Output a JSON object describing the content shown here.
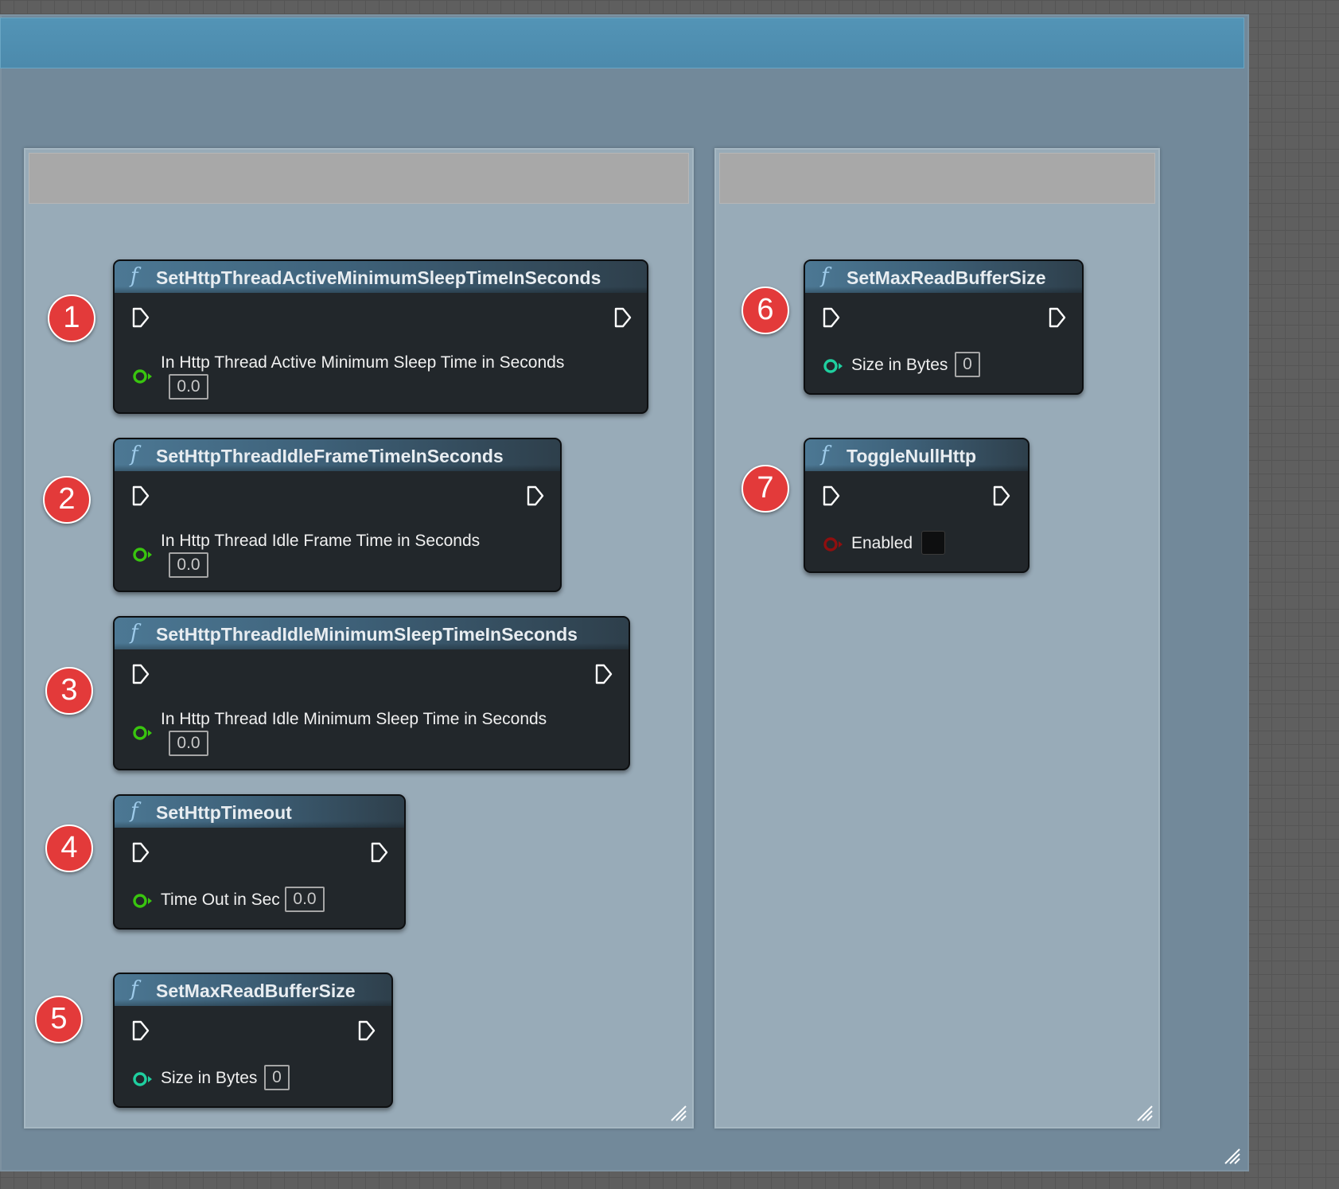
{
  "outer_comment": {
    "title": ""
  },
  "groups": [
    {
      "title": ""
    },
    {
      "title": ""
    }
  ],
  "badges": [
    "1",
    "2",
    "3",
    "4",
    "5",
    "6",
    "7"
  ],
  "nodes": [
    {
      "title": "SetHttpThreadActiveMinimumSleepTimeInSeconds",
      "param": "In Http Thread Active Minimum Sleep Time in Seconds",
      "value": "0.0",
      "pin_type": "float"
    },
    {
      "title": "SetHttpThreadIdleFrameTimeInSeconds",
      "param": "In Http Thread Idle Frame Time in Seconds",
      "value": "0.0",
      "pin_type": "float"
    },
    {
      "title": "SetHttpThreadIdleMinimumSleepTimeInSeconds",
      "param": "In Http Thread Idle Minimum Sleep Time in Seconds",
      "value": "0.0",
      "pin_type": "float"
    },
    {
      "title": "SetHttpTimeout",
      "param": "Time Out in Sec",
      "value": "0.0",
      "pin_type": "float"
    },
    {
      "title": "SetMaxReadBufferSize",
      "param": "Size in Bytes",
      "value": "0",
      "pin_type": "integer"
    },
    {
      "title": "SetMaxReadBufferSize",
      "param": "Size in Bytes",
      "value": "0",
      "pin_type": "integer"
    },
    {
      "title": "ToggleNullHttp",
      "param": "Enabled",
      "value": "",
      "pin_type": "boolean",
      "checked": false
    }
  ],
  "icons": {
    "function": "function-icon",
    "exec": "exec-pin-icon",
    "data": "data-pin-icon"
  },
  "colors": {
    "float_pin": "#39c50f",
    "integer_pin": "#1fcf9f",
    "boolean_pin": "#8e0f0f",
    "badge": "#e33a3a",
    "outer_header": "#5394b6"
  },
  "function_symbol": "f"
}
